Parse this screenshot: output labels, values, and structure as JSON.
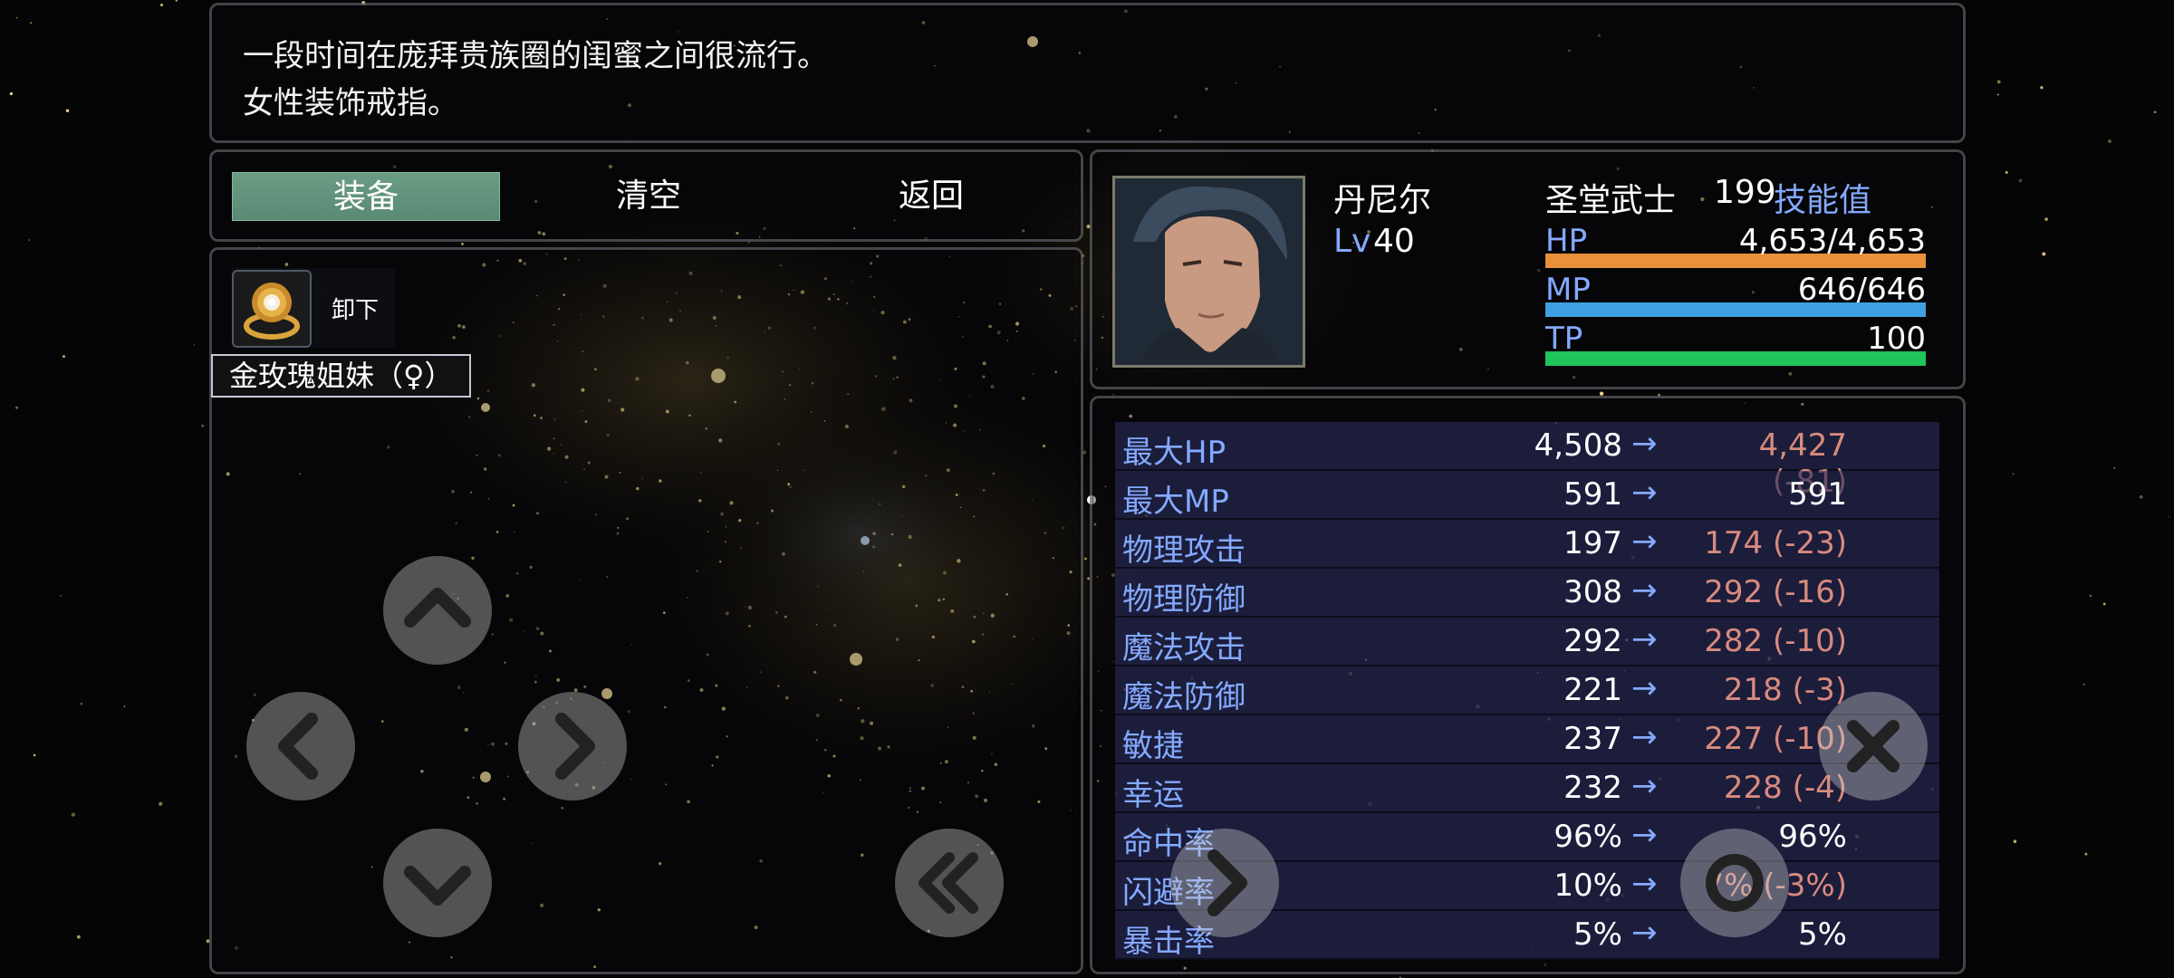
{
  "help": {
    "line1": "一段时间在庞拜贵族圈的闺蜜之间很流行。",
    "line2": "女性装饰戒指。"
  },
  "commands": [
    {
      "label": "装备",
      "selected": true
    },
    {
      "label": "清空",
      "selected": false
    },
    {
      "label": "返回",
      "selected": false
    }
  ],
  "slot": {
    "icon": "gold-rose-ring-icon",
    "action_label": "卸下",
    "item_name": "金玫瑰姐妹（♀）"
  },
  "actor": {
    "name": "丹尼尔",
    "level_label": "Lv",
    "level": "40",
    "class": "圣堂武士",
    "skill_points": "199",
    "skill_points_label": "技能值",
    "hp": {
      "label": "HP",
      "value": "4,653/4,653",
      "ratio": 1.0,
      "color": "#e8903a"
    },
    "mp": {
      "label": "MP",
      "value": "646/646",
      "ratio": 1.0,
      "color": "#3ea0e0"
    },
    "tp": {
      "label": "TP",
      "value": "100",
      "ratio": 1.0,
      "color": "#1fc45a"
    }
  },
  "params": [
    {
      "name": "最大HP",
      "old": "4,508",
      "arrow": "→",
      "new": "4,427 (-81)",
      "down": true
    },
    {
      "name": "最大MP",
      "old": "591",
      "arrow": "→",
      "new": "591",
      "down": false
    },
    {
      "name": "物理攻击",
      "old": "197",
      "arrow": "→",
      "new": "174 (-23)",
      "down": true
    },
    {
      "name": "物理防御",
      "old": "308",
      "arrow": "→",
      "new": "292 (-16)",
      "down": true
    },
    {
      "name": "魔法攻击",
      "old": "292",
      "arrow": "→",
      "new": "282 (-10)",
      "down": true
    },
    {
      "name": "魔法防御",
      "old": "221",
      "arrow": "→",
      "new": "218 (-3)",
      "down": true
    },
    {
      "name": "敏捷",
      "old": "237",
      "arrow": "→",
      "new": "227 (-10)",
      "down": true
    },
    {
      "name": "幸运",
      "old": "232",
      "arrow": "→",
      "new": "228 (-4)",
      "down": true
    },
    {
      "name": "命中率",
      "old": "96%",
      "arrow": "→",
      "new": "96%",
      "down": false
    },
    {
      "name": "闪避率",
      "old": "10%",
      "arrow": "→",
      "new": "7% (-3%)",
      "down": true
    },
    {
      "name": "暴击率",
      "old": "5%",
      "arrow": "→",
      "new": "5%",
      "down": false
    }
  ],
  "touch_buttons": {
    "up": "chevron-up-icon",
    "down": "chevron-down-icon",
    "left": "chevron-left-icon",
    "right": "chevron-right-icon",
    "page": "double-chevron-left-icon",
    "cancel": "close-icon",
    "ok": "circle-icon",
    "next": "chevron-right-icon"
  }
}
